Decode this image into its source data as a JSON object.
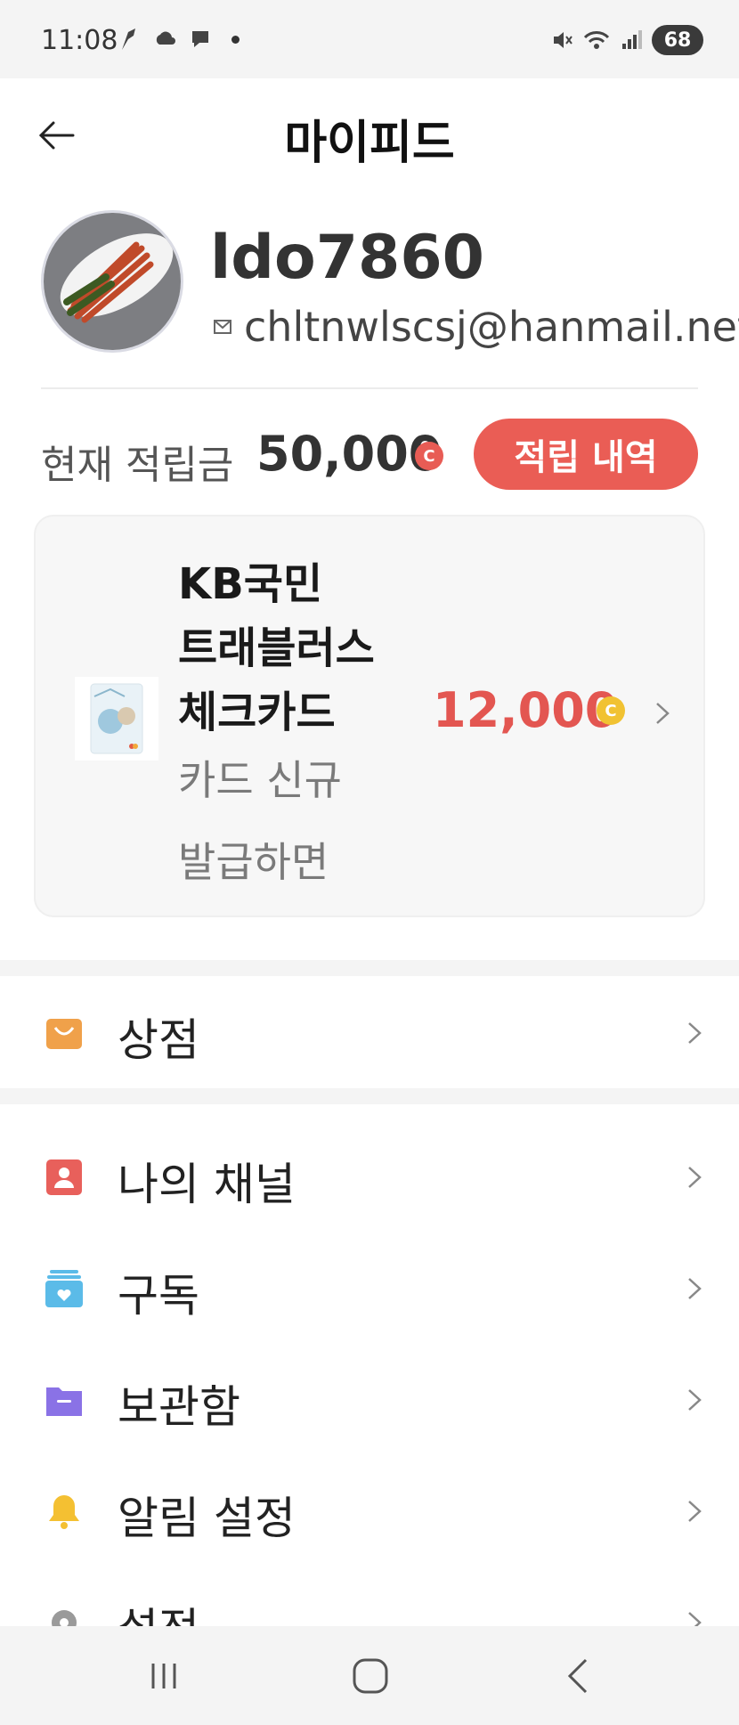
{
  "status_bar": {
    "time": "11:08",
    "battery": "68",
    "left_icons": [
      "quill-icon",
      "cloud-icon",
      "chat-icon"
    ],
    "right_icons": [
      "mute-icon",
      "wifi-icon",
      "signal-icon"
    ]
  },
  "header": {
    "title": "마이피드",
    "back_icon": "back-arrow-icon"
  },
  "profile": {
    "username": "ldo7860",
    "email": "chltnwlscsj@hanmail.net"
  },
  "points": {
    "label": "현재 적립금",
    "value": "50,000",
    "currency_mark": "C",
    "history_button": "적립 내역"
  },
  "card_promo": {
    "name": "KB국민\n트래블러스\n체크카드",
    "description": "카드 신규\n발급하면",
    "amount": "12,000",
    "currency_mark": "C"
  },
  "menu": {
    "shop": {
      "label": "상점",
      "icon": "shopping-bag-icon"
    },
    "items": [
      {
        "label": "나의 채널",
        "icon": "person-badge-icon"
      },
      {
        "label": "구독",
        "icon": "subscription-icon"
      },
      {
        "label": "보관함",
        "icon": "folder-icon"
      },
      {
        "label": "알림 설정",
        "icon": "bell-icon"
      },
      {
        "label": "설정",
        "icon": "gear-icon"
      }
    ]
  },
  "nav_bar": {
    "buttons": [
      "recent-apps-icon",
      "home-icon",
      "nav-back-icon"
    ]
  },
  "colors": {
    "accent_red": "#ea5d55",
    "coin_yellow": "#f1c232",
    "shop_orange": "#f0a14a",
    "channel_red": "#e8605b",
    "subscribe_blue": "#5bbbe8",
    "folder_purple": "#8a72e6",
    "bell_yellow": "#f4c032"
  }
}
